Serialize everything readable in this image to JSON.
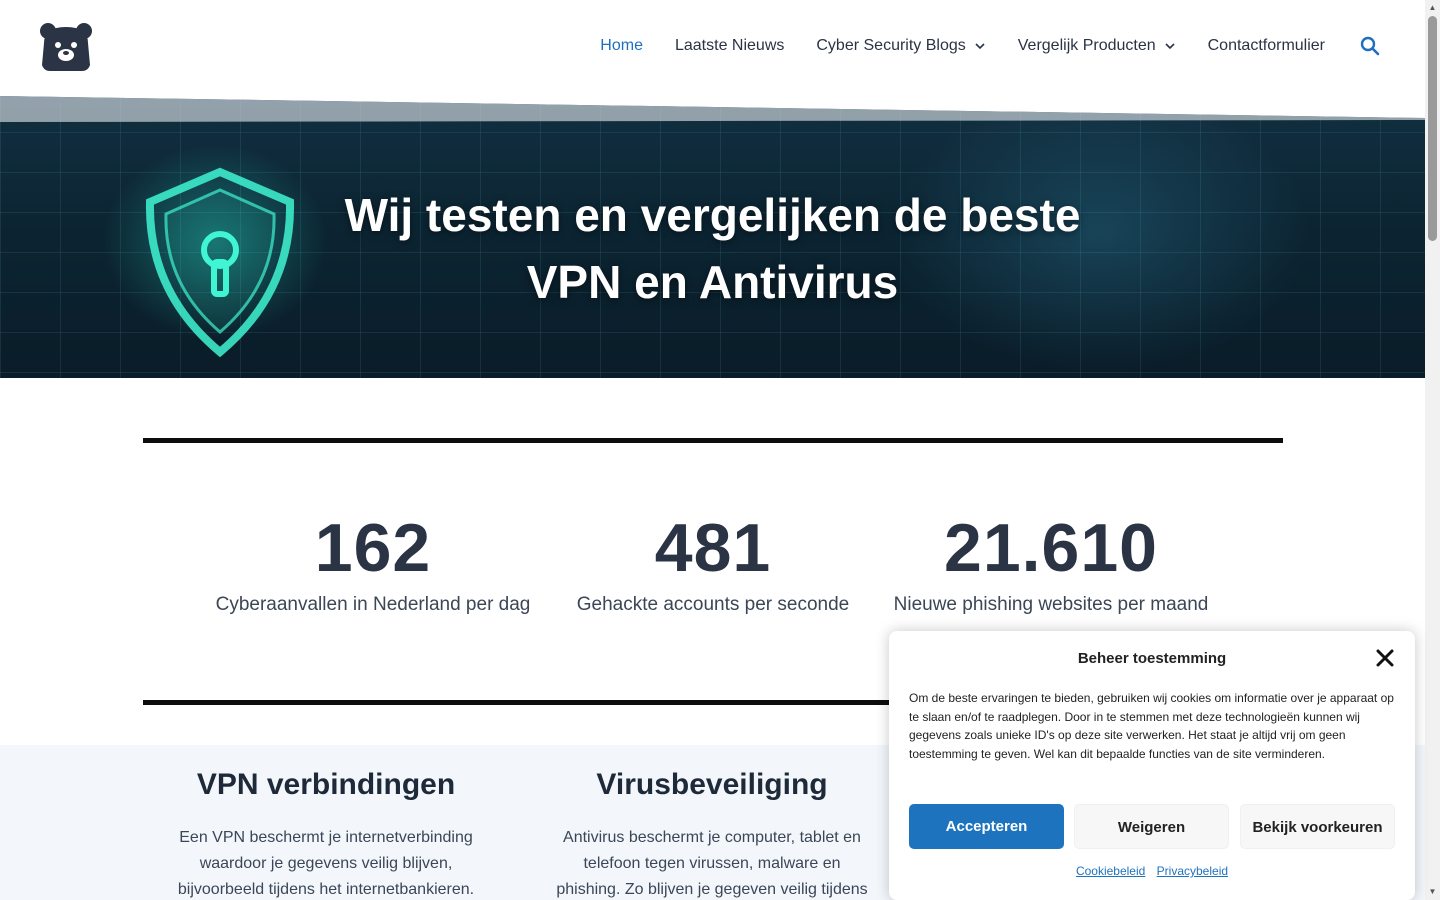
{
  "nav": {
    "items": [
      {
        "label": "Home",
        "active": true,
        "has_dropdown": false
      },
      {
        "label": "Laatste Nieuws",
        "active": false,
        "has_dropdown": false
      },
      {
        "label": "Cyber Security Blogs",
        "active": false,
        "has_dropdown": true
      },
      {
        "label": "Vergelijk Producten",
        "active": false,
        "has_dropdown": true
      },
      {
        "label": "Contactformulier",
        "active": false,
        "has_dropdown": false
      }
    ],
    "search_icon": "search-icon",
    "logo_icon": "bear-logo-icon"
  },
  "hero": {
    "line1": "Wij testen en vergelijken de beste",
    "line2": "VPN en Antivirus"
  },
  "stats": [
    {
      "number": "162",
      "label": "Cyberaanvallen in Nederland per dag"
    },
    {
      "number": "481",
      "label": "Gehackte accounts per seconde"
    },
    {
      "number": "21.610",
      "label": "Nieuwe phishing websites per maand"
    }
  ],
  "features": [
    {
      "title": "VPN verbindingen",
      "lines": [
        "Een VPN beschermt je internetverbinding",
        "waardoor je gegevens veilig blijven,",
        "bijvoorbeeld tijdens het internetbankieren."
      ]
    },
    {
      "title": "Virusbeveiliging",
      "lines": [
        "Antivirus beschermt je computer, tablet en",
        "telefoon tegen virussen, malware en",
        "phishing. Zo blijven je gegeven veilig tijdens"
      ]
    }
  ],
  "cookie": {
    "title": "Beheer toestemming",
    "text": "Om de beste ervaringen te bieden, gebruiken wij cookies om informatie over je apparaat op te slaan en/of te raadplegen. Door in te stemmen met deze technologieën kunnen wij gegevens zoals unieke ID's op deze site verwerken. Het staat je altijd vrij om geen toestemming te geven. Wel kan dit bepaalde functies van de site verminderen.",
    "accept_label": "Accepteren",
    "deny_label": "Weigeren",
    "prefs_label": "Bekijk voorkeuren",
    "link_cookie": "Cookiebeleid",
    "link_privacy": "Privacybeleid"
  },
  "colors": {
    "accent": "#1e73be",
    "nav_active": "#1f6fc1",
    "text": "#2b3444"
  }
}
